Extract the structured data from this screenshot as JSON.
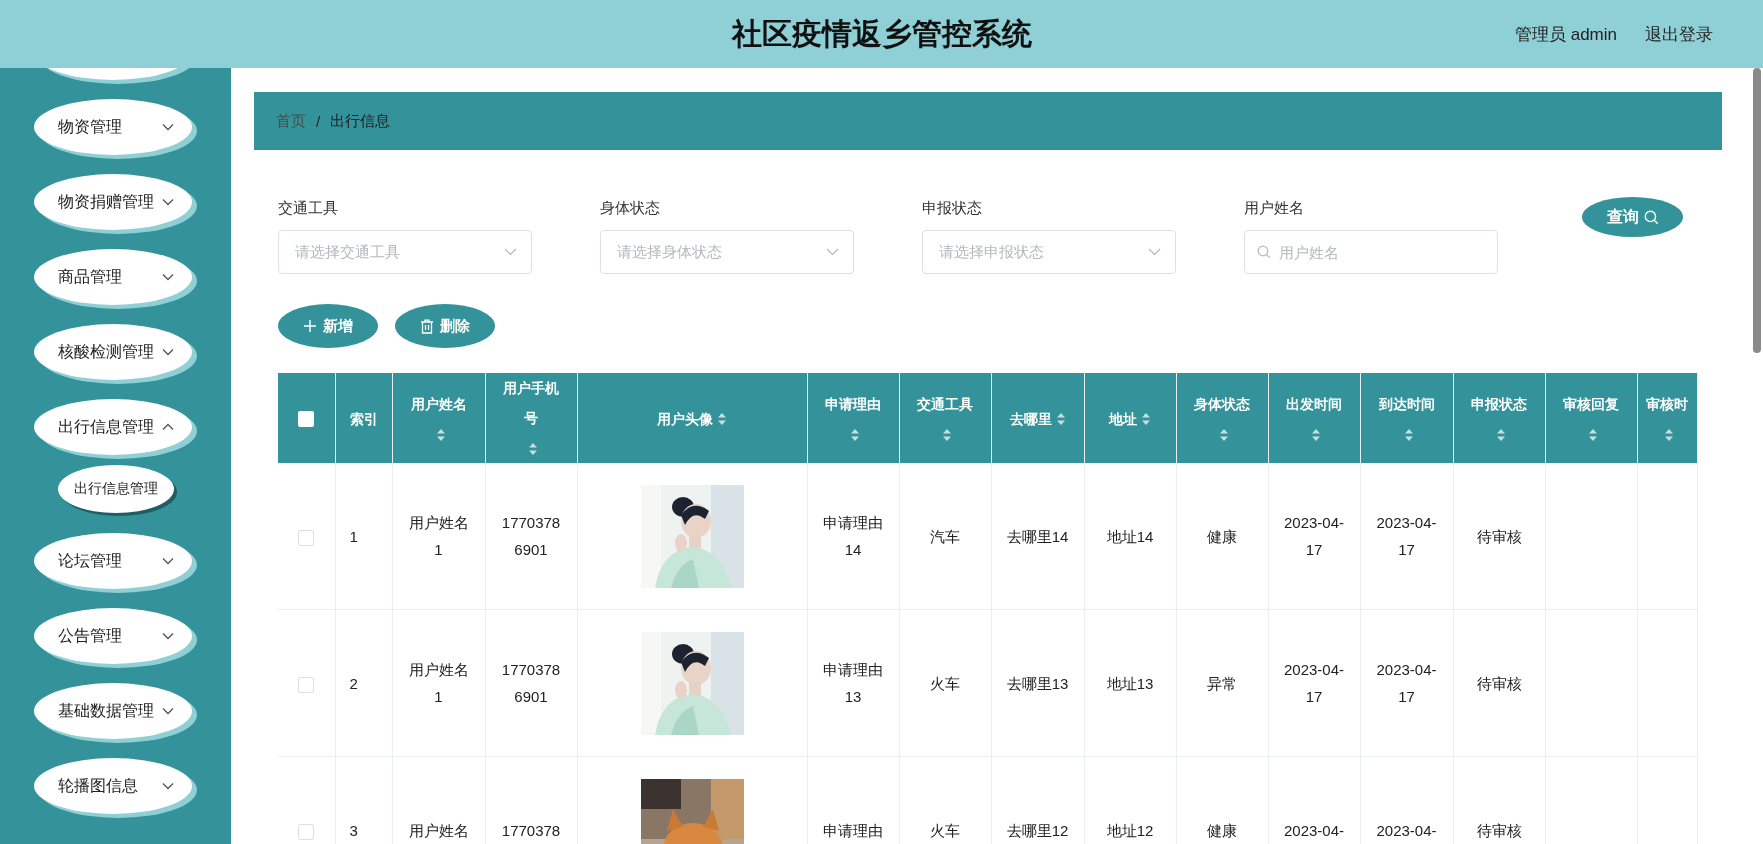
{
  "header": {
    "title": "社区疫情返乡管控系统",
    "user": "管理员 admin",
    "logout": "退出登录"
  },
  "sidebar": {
    "items": [
      {
        "label": "物资管理",
        "expanded": false
      },
      {
        "label": "物资捐赠管理",
        "expanded": false
      },
      {
        "label": "商品管理",
        "expanded": false
      },
      {
        "label": "核酸检测管理",
        "expanded": false
      },
      {
        "label": "出行信息管理",
        "expanded": true,
        "children": [
          {
            "label": "出行信息管理"
          }
        ]
      },
      {
        "label": "论坛管理",
        "expanded": false
      },
      {
        "label": "公告管理",
        "expanded": false
      },
      {
        "label": "基础数据管理",
        "expanded": false
      },
      {
        "label": "轮播图信息",
        "expanded": false
      }
    ]
  },
  "breadcrumb": [
    "首页",
    "/",
    "出行信息"
  ],
  "filters": [
    {
      "kind": "select",
      "label": "交通工具",
      "placeholder": "请选择交通工具"
    },
    {
      "kind": "select",
      "label": "身体状态",
      "placeholder": "请选择身体状态"
    },
    {
      "kind": "select",
      "label": "申报状态",
      "placeholder": "请选择申报状态"
    },
    {
      "kind": "search",
      "label": "用户姓名",
      "placeholder": "用户姓名"
    }
  ],
  "query_button": "查询",
  "actions": [
    {
      "kind": "add",
      "label": "新增"
    },
    {
      "kind": "delete",
      "label": "删除"
    }
  ],
  "table": {
    "select_all": {
      "checked": false
    },
    "columns": [
      {
        "label": "索引",
        "sortable": false
      },
      {
        "label": "用户姓名",
        "sortable": true
      },
      {
        "label": "用户手机号",
        "sortable": true
      },
      {
        "label": "用户头像",
        "sortable": true
      },
      {
        "label": "申请理由",
        "sortable": true
      },
      {
        "label": "交通工具",
        "sortable": true
      },
      {
        "label": "去哪里",
        "sortable": true
      },
      {
        "label": "地址",
        "sortable": true
      },
      {
        "label": "身体状态",
        "sortable": true
      },
      {
        "label": "出发时间",
        "sortable": true
      },
      {
        "label": "到达时间",
        "sortable": true
      },
      {
        "label": "申报状态",
        "sortable": true
      },
      {
        "label": "审核回复",
        "sortable": true
      },
      {
        "label": "审核时",
        "sortable": true
      }
    ],
    "rows": [
      {
        "checked": false,
        "cells": [
          "1",
          "用户姓名1",
          "17703786901",
          {
            "kind": "picture"
          },
          "申请理由14",
          "汽车",
          "去哪里14",
          "地址14",
          "健康",
          "2023-04-17",
          "2023-04-17",
          "待审核"
        ]
      },
      {
        "checked": false,
        "cells": [
          "2",
          "用户姓名1",
          "17703786901",
          {
            "kind": "picture"
          },
          "申请理由13",
          "火车",
          "去哪里13",
          "地址13",
          "异常",
          "2023-04-17",
          "2023-04-17",
          "待审核"
        ]
      },
      {
        "checked": false,
        "cells": [
          "3",
          "用户姓名",
          "1770378",
          {
            "kind": "picture"
          },
          "申请理由",
          "火车",
          "去哪里12",
          "地址12",
          "健康",
          "2023-04-",
          "2023-04-",
          "待审核"
        ]
      }
    ]
  }
}
